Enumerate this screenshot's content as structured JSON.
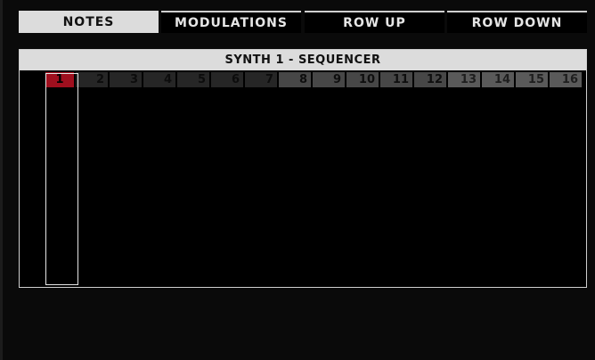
{
  "tabs": [
    {
      "label": "NOTES",
      "active": true
    },
    {
      "label": "MODULATIONS",
      "active": false
    },
    {
      "label": "ROW UP",
      "active": false
    },
    {
      "label": "ROW DOWN",
      "active": false
    }
  ],
  "panel": {
    "title": "SYNTH 1 - SEQUENCER"
  },
  "sequencer": {
    "steps": [
      "1",
      "2",
      "3",
      "4",
      "5",
      "6",
      "7",
      "8",
      "9",
      "10",
      "11",
      "12",
      "13",
      "14",
      "15",
      "16"
    ],
    "current_step": "1"
  },
  "colors": {
    "active_step": "#9f0f1e",
    "tab_active_bg": "#dcdcdc",
    "panel_bg": "#000000"
  }
}
